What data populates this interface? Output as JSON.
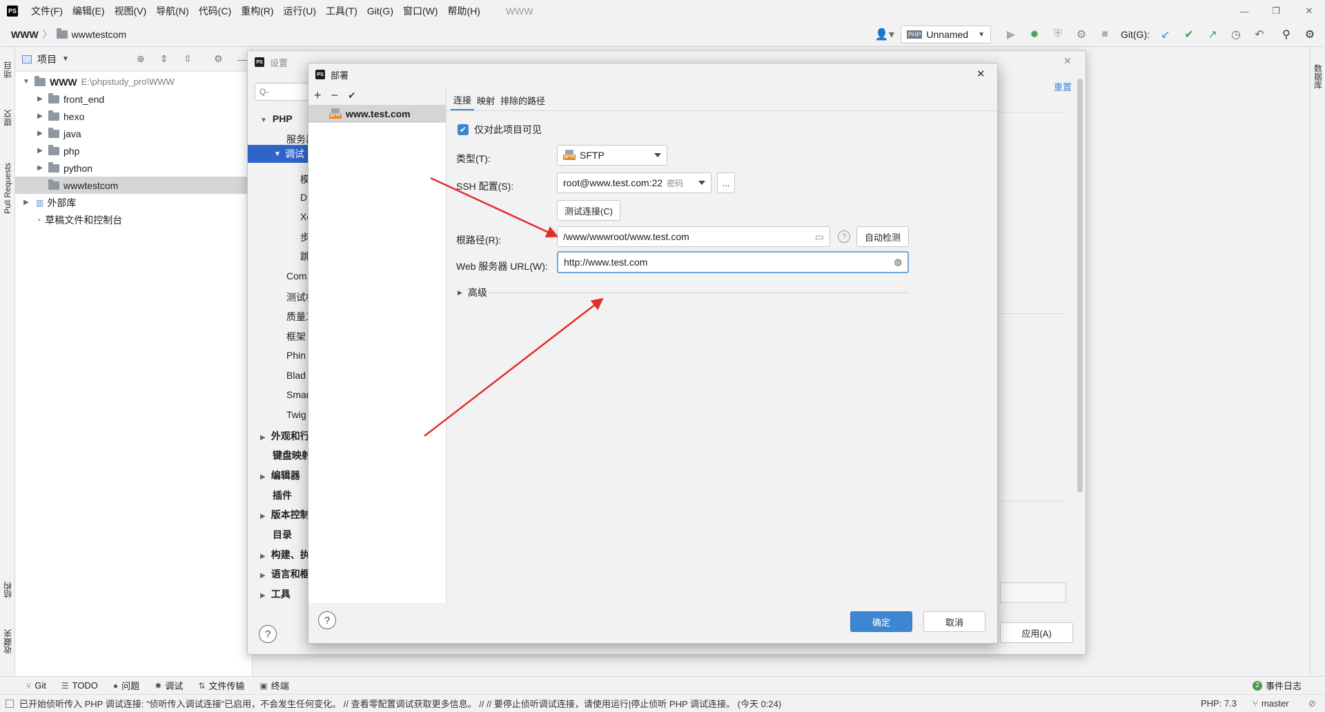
{
  "app": {
    "logo": "PS",
    "menu": [
      "文件(F)",
      "编辑(E)",
      "视图(V)",
      "导航(N)",
      "代码(C)",
      "重构(R)",
      "运行(U)",
      "工具(T)",
      "Git(G)",
      "窗口(W)",
      "帮助(H)"
    ],
    "window_title": "WWW"
  },
  "navbar": {
    "root": "WWW",
    "child": "wwwtestcom",
    "run_config": "Unnamed",
    "git_label": "Git(G):"
  },
  "left_strip": {
    "project": "项目",
    "commit": "提交",
    "pull_requests": "Pull Requests",
    "structure": "结构",
    "favorites": "收藏夹"
  },
  "right_strip": {
    "database": "数据库"
  },
  "project_panel": {
    "header": "项目",
    "tree": [
      {
        "label": "WWW",
        "path": "E:\\phpstudy_pro\\WWW"
      },
      {
        "label": "front_end"
      },
      {
        "label": "hexo"
      },
      {
        "label": "java"
      },
      {
        "label": "php"
      },
      {
        "label": "python"
      },
      {
        "label": "wwwtestcom"
      },
      {
        "label": "外部库"
      },
      {
        "label": "草稿文件和控制台"
      }
    ]
  },
  "settings": {
    "title": "设置",
    "search_placeholder": "Q-",
    "reset": "重置",
    "tree": [
      "PHP",
      "服务器",
      "调试",
      "模",
      "D",
      "Xe",
      "步",
      "跳",
      "Com",
      "测试框",
      "质量工",
      "框架",
      "Phin",
      "Blad",
      "Smar",
      "Twig",
      "外观和行",
      "键盘映射",
      "编辑器",
      "插件",
      "版本控制",
      "目录",
      "构建、执",
      "语言和框",
      "工具"
    ],
    "apply": "应用(A)",
    "help": "?"
  },
  "deploy": {
    "title": "部署",
    "toolbar": {
      "add": "+",
      "remove": "−",
      "check": "✔"
    },
    "server_name": "www.test.com",
    "tabs": [
      "连接",
      "映射",
      "排除的路径"
    ],
    "visible_only_label": "仅对此项目可见",
    "type_label": "类型(T):",
    "type_value": "SFTP",
    "ssh_label": "SSH 配置(S):",
    "ssh_value": "root@www.test.com:22",
    "ssh_hint": "密码",
    "ellipsis": "...",
    "test_button": "测试连接(C)",
    "root_label": "根路径(R):",
    "root_value": "/www/wwwroot/www.test.com",
    "auto_detect": "自动检测",
    "url_label": "Web 服务器 URL(W):",
    "url_value": "http://www.test.com",
    "advanced": "高级",
    "ok": "确定",
    "cancel": "取消",
    "help": "?"
  },
  "bottom_tabs": [
    "Git",
    "TODO",
    "问题",
    "调试",
    "文件传输",
    "终端"
  ],
  "event_log": {
    "count": "2",
    "label": "事件日志"
  },
  "status": {
    "message": "已开始侦听传入 PHP 调试连接: \"侦听传入调试连接\"已启用，不会发生任何变化。 // 查看零配置调试获取更多信息。 // // 要停止侦听调试连接，请使用运行|停止侦听 PHP 调试连接。 (今天 0:24)",
    "php": "PHP: 7.3",
    "branch": "master"
  },
  "colors": {
    "accent": "#3d86d1",
    "selection": "#2f65ca",
    "arrow": "#e52a2a"
  }
}
